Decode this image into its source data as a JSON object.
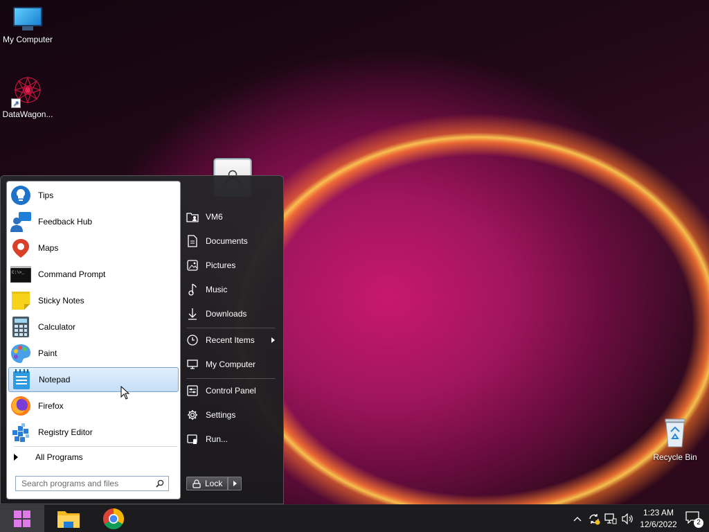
{
  "desktop": {
    "icons": [
      {
        "label": "My Computer"
      },
      {
        "label": "DataWagon..."
      }
    ],
    "recycle_bin": {
      "label": "Recycle Bin"
    }
  },
  "start_menu": {
    "programs": [
      {
        "label": "Tips",
        "icon": "tips-icon"
      },
      {
        "label": "Feedback Hub",
        "icon": "feedback-hub-icon"
      },
      {
        "label": "Maps",
        "icon": "maps-icon"
      },
      {
        "label": "Command Prompt",
        "icon": "command-prompt-icon"
      },
      {
        "label": "Sticky Notes",
        "icon": "sticky-notes-icon"
      },
      {
        "label": "Calculator",
        "icon": "calculator-icon"
      },
      {
        "label": "Paint",
        "icon": "paint-icon"
      },
      {
        "label": "Notepad",
        "icon": "notepad-icon",
        "selected": true
      },
      {
        "label": "Firefox",
        "icon": "firefox-icon"
      },
      {
        "label": "Registry Editor",
        "icon": "registry-editor-icon"
      }
    ],
    "all_programs_label": "All Programs",
    "search_placeholder": "Search programs and files",
    "right_items": [
      {
        "label": "VM6",
        "icon": "user-folder-icon"
      },
      {
        "label": "Documents",
        "icon": "document-icon"
      },
      {
        "label": "Pictures",
        "icon": "picture-icon"
      },
      {
        "label": "Music",
        "icon": "music-icon"
      },
      {
        "label": "Downloads",
        "icon": "download-icon"
      },
      {
        "label": "Recent Items",
        "icon": "clock-icon"
      },
      {
        "label": "My Computer",
        "icon": "computer-icon"
      },
      {
        "label": "Control Panel",
        "icon": "control-panel-icon"
      },
      {
        "label": "Settings",
        "icon": "gear-icon"
      },
      {
        "label": "Run...",
        "icon": "run-icon"
      }
    ],
    "lock_label": "Lock"
  },
  "taskbar": {
    "pinned": [
      {
        "name": "file-explorer"
      },
      {
        "name": "chrome"
      }
    ],
    "clock_time": "1:23 AM",
    "clock_date": "12/6/2022",
    "notification_count": "2"
  }
}
